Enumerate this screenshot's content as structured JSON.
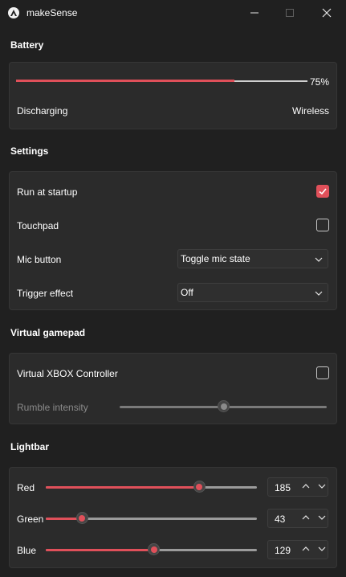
{
  "window": {
    "title": "makeSense",
    "icons": {
      "app": "app-logo-icon",
      "minimize": "minimize-icon",
      "maximize": "maximize-icon",
      "close": "close-icon"
    }
  },
  "battery": {
    "heading": "Battery",
    "level_percent": 75,
    "level_label": "75%",
    "status": "Discharging",
    "connection": "Wireless"
  },
  "settings": {
    "heading": "Settings",
    "run_at_startup": {
      "label": "Run at startup",
      "checked": true
    },
    "touchpad": {
      "label": "Touchpad",
      "checked": false
    },
    "mic_button": {
      "label": "Mic button",
      "value": "Toggle mic state"
    },
    "trigger_effect": {
      "label": "Trigger effect",
      "value": "Off"
    }
  },
  "virtual_gamepad": {
    "heading": "Virtual gamepad",
    "xbox_controller": {
      "label": "Virtual XBOX Controller",
      "checked": false
    },
    "rumble": {
      "label": "Rumble intensity",
      "value_fraction": 0.5,
      "enabled": false
    }
  },
  "lightbar": {
    "heading": "Lightbar",
    "max": 255,
    "channels": [
      {
        "label": "Red",
        "value": "185",
        "fraction": 0.725
      },
      {
        "label": "Green",
        "value": "43",
        "fraction": 0.17
      },
      {
        "label": "Blue",
        "value": "129",
        "fraction": 0.51
      }
    ]
  },
  "colors": {
    "accent": "#e0505a",
    "background": "#202020",
    "card": "#2b2b2b"
  }
}
